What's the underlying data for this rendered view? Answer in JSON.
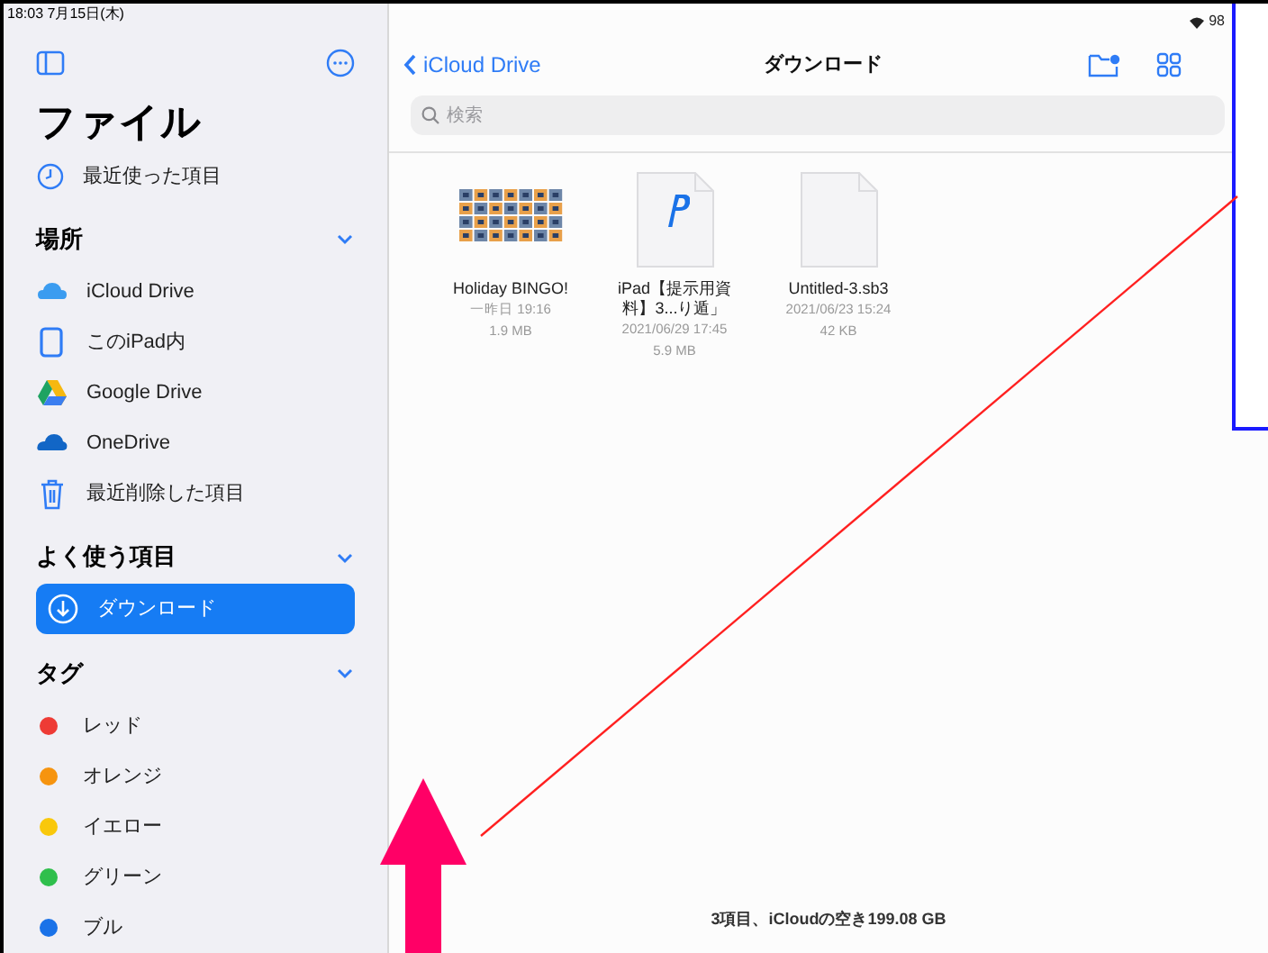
{
  "status_bar": {
    "time": "18:03  7月15日(木)",
    "battery": "98"
  },
  "sidebar": {
    "title": "ファイル",
    "recents": {
      "label": "最近使った項目",
      "selected": false
    },
    "sections": [
      {
        "title": "場所",
        "items": [
          {
            "label": "iCloud Drive",
            "kind": "icloud",
            "selected": false
          },
          {
            "label": "このiPad内",
            "kind": "ipad",
            "selected": false
          },
          {
            "label": "Google Drive",
            "kind": "gdrive",
            "selected": false
          },
          {
            "label": "OneDrive",
            "kind": "onedrive",
            "selected": false
          },
          {
            "label": "最近削除した項目",
            "kind": "trash",
            "selected": false
          }
        ]
      },
      {
        "title": "よく使う項目",
        "items": [
          {
            "label": "ダウンロード",
            "kind": "download",
            "selected": true
          }
        ]
      },
      {
        "title": "タグ",
        "items": [
          {
            "label": "レッド",
            "kind": "tag",
            "color": "#ee3b35",
            "selected": false
          },
          {
            "label": "オレンジ",
            "kind": "tag",
            "color": "#f6940f",
            "selected": false
          },
          {
            "label": "イエロー",
            "kind": "tag",
            "color": "#f9c80b",
            "selected": false
          },
          {
            "label": "グリーン",
            "kind": "tag",
            "color": "#2fbf4c",
            "selected": false
          },
          {
            "label": "ブル",
            "kind": "tag",
            "color": "#1a72e8",
            "selected": false
          }
        ]
      }
    ]
  },
  "nav": {
    "back": "iCloud Drive",
    "title": "ダウンロード"
  },
  "search": {
    "placeholder": "検索"
  },
  "files": [
    {
      "name": "Holiday BINGO!",
      "kind": "image",
      "lines": [
        "一昨日 19:16",
        "1.9 MB"
      ]
    },
    {
      "name": "iPad【提示用資料】3...り遁」",
      "kind": "pages",
      "lines": [
        "2021/06/29 17:45",
        "5.9 MB"
      ]
    },
    {
      "name": "Untitled-3.sb3",
      "kind": "blank",
      "lines": [
        "2021/06/23 15:24",
        "42 KB"
      ]
    }
  ],
  "footer": "3項目、iCloudの空き199.08 GB"
}
